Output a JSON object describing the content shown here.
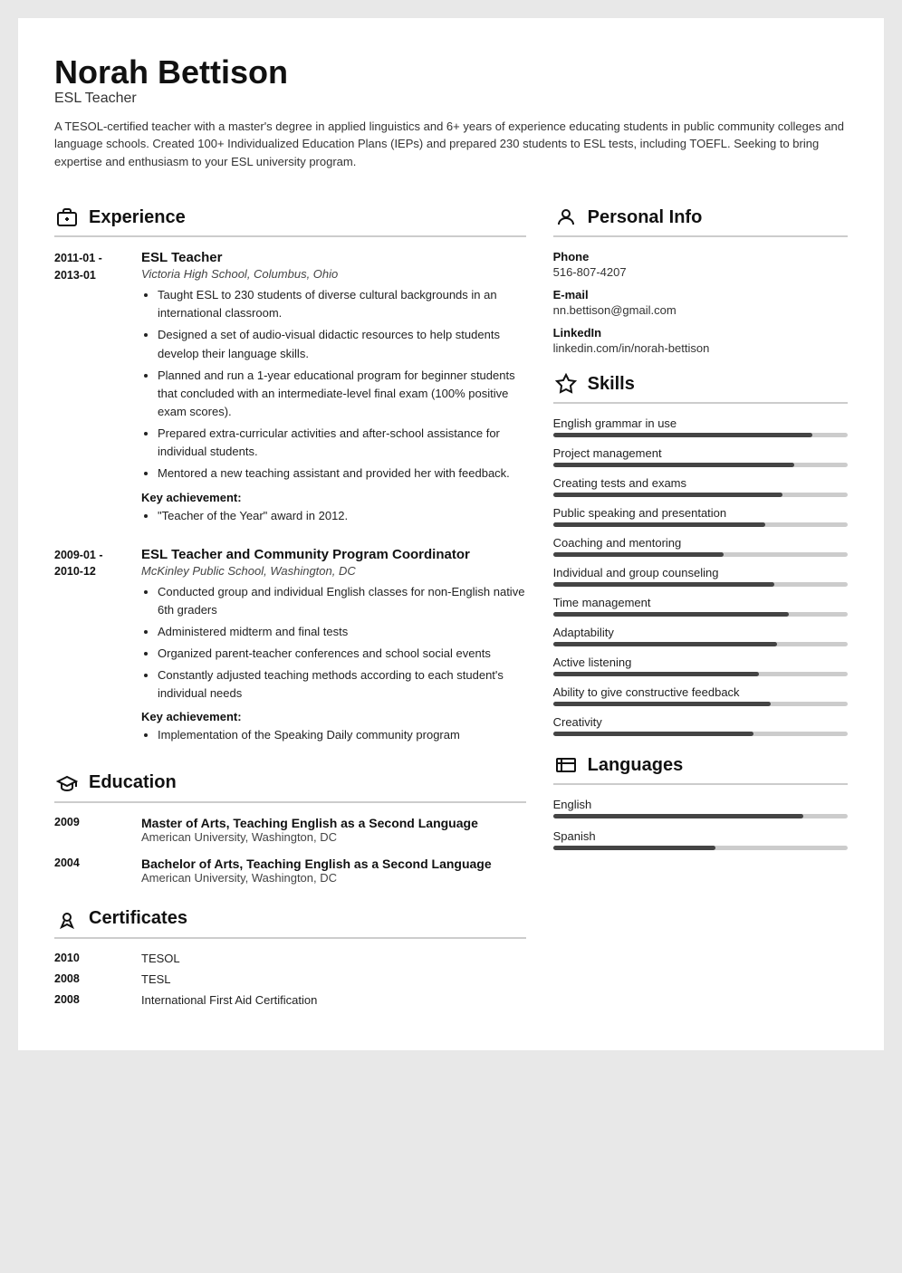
{
  "resume": {
    "name": "Norah Bettison",
    "title": "ESL Teacher",
    "summary": "A TESOL-certified teacher with a master's degree in applied linguistics and 6+ years of experience educating students in public community colleges and language schools. Created 100+ Individualized Education Plans (IEPs) and prepared 230 students to ESL tests, including TOEFL. Seeking to bring expertise and enthusiasm to your ESL university program.",
    "experience": {
      "section_title": "Experience",
      "jobs": [
        {
          "date_start": "2011-01 -",
          "date_end": "2013-01",
          "title": "ESL Teacher",
          "school": "Victoria High School, Columbus, Ohio",
          "bullets": [
            "Taught ESL to 230 students of diverse cultural backgrounds in an international classroom.",
            "Designed a set of audio-visual didactic resources to help students develop their language skills.",
            "Planned and run a 1-year educational program for beginner students that concluded with an intermediate-level final exam (100% positive exam scores).",
            "Prepared extra-curricular activities and after-school assistance for individual students.",
            "Mentored a new teaching assistant and provided her with feedback."
          ],
          "key_achievement_label": "Key achievement:",
          "key_achievement": "\"Teacher of the Year\" award in 2012."
        },
        {
          "date_start": "2009-01 -",
          "date_end": "2010-12",
          "title": "ESL Teacher and Community Program Coordinator",
          "school": "McKinley Public School, Washington, DC",
          "bullets": [
            "Conducted group and individual English classes for non-English native 6th graders",
            "Administered midterm and final tests",
            "Organized parent-teacher conferences and school social events",
            "Constantly adjusted teaching methods according to each student's individual needs"
          ],
          "key_achievement_label": "Key achievement:",
          "key_achievement": "Implementation of the Speaking Daily community program"
        }
      ]
    },
    "education": {
      "section_title": "Education",
      "items": [
        {
          "year": "2009",
          "degree": "Master of Arts, Teaching English as a Second Language",
          "school": "American University, Washington, DC"
        },
        {
          "year": "2004",
          "degree": "Bachelor of Arts, Teaching English as a Second Language",
          "school": "American University, Washington, DC"
        }
      ]
    },
    "certificates": {
      "section_title": "Certificates",
      "items": [
        {
          "year": "2010",
          "name": "TESOL"
        },
        {
          "year": "2008",
          "name": "TESL"
        },
        {
          "year": "2008",
          "name": "International First Aid Certification"
        }
      ]
    },
    "personal_info": {
      "section_title": "Personal Info",
      "phone_label": "Phone",
      "phone": "516-807-4207",
      "email_label": "E-mail",
      "email": "nn.bettison@gmail.com",
      "linkedin_label": "LinkedIn",
      "linkedin": "linkedin.com/in/norah-bettison"
    },
    "skills": {
      "section_title": "Skills",
      "items": [
        {
          "name": "English grammar in use",
          "pct": 88
        },
        {
          "name": "Project management",
          "pct": 82
        },
        {
          "name": "Creating tests and exams",
          "pct": 78
        },
        {
          "name": "Public speaking and presentation",
          "pct": 72
        },
        {
          "name": "Coaching and mentoring",
          "pct": 58
        },
        {
          "name": "Individual and group counseling",
          "pct": 75
        },
        {
          "name": "Time management",
          "pct": 80
        },
        {
          "name": "Adaptability",
          "pct": 76
        },
        {
          "name": "Active listening",
          "pct": 70
        },
        {
          "name": "Ability to give constructive feedback",
          "pct": 74
        },
        {
          "name": "Creativity",
          "pct": 68
        }
      ]
    },
    "languages": {
      "section_title": "Languages",
      "items": [
        {
          "name": "English",
          "pct": 85
        },
        {
          "name": "Spanish",
          "pct": 55
        }
      ]
    }
  }
}
